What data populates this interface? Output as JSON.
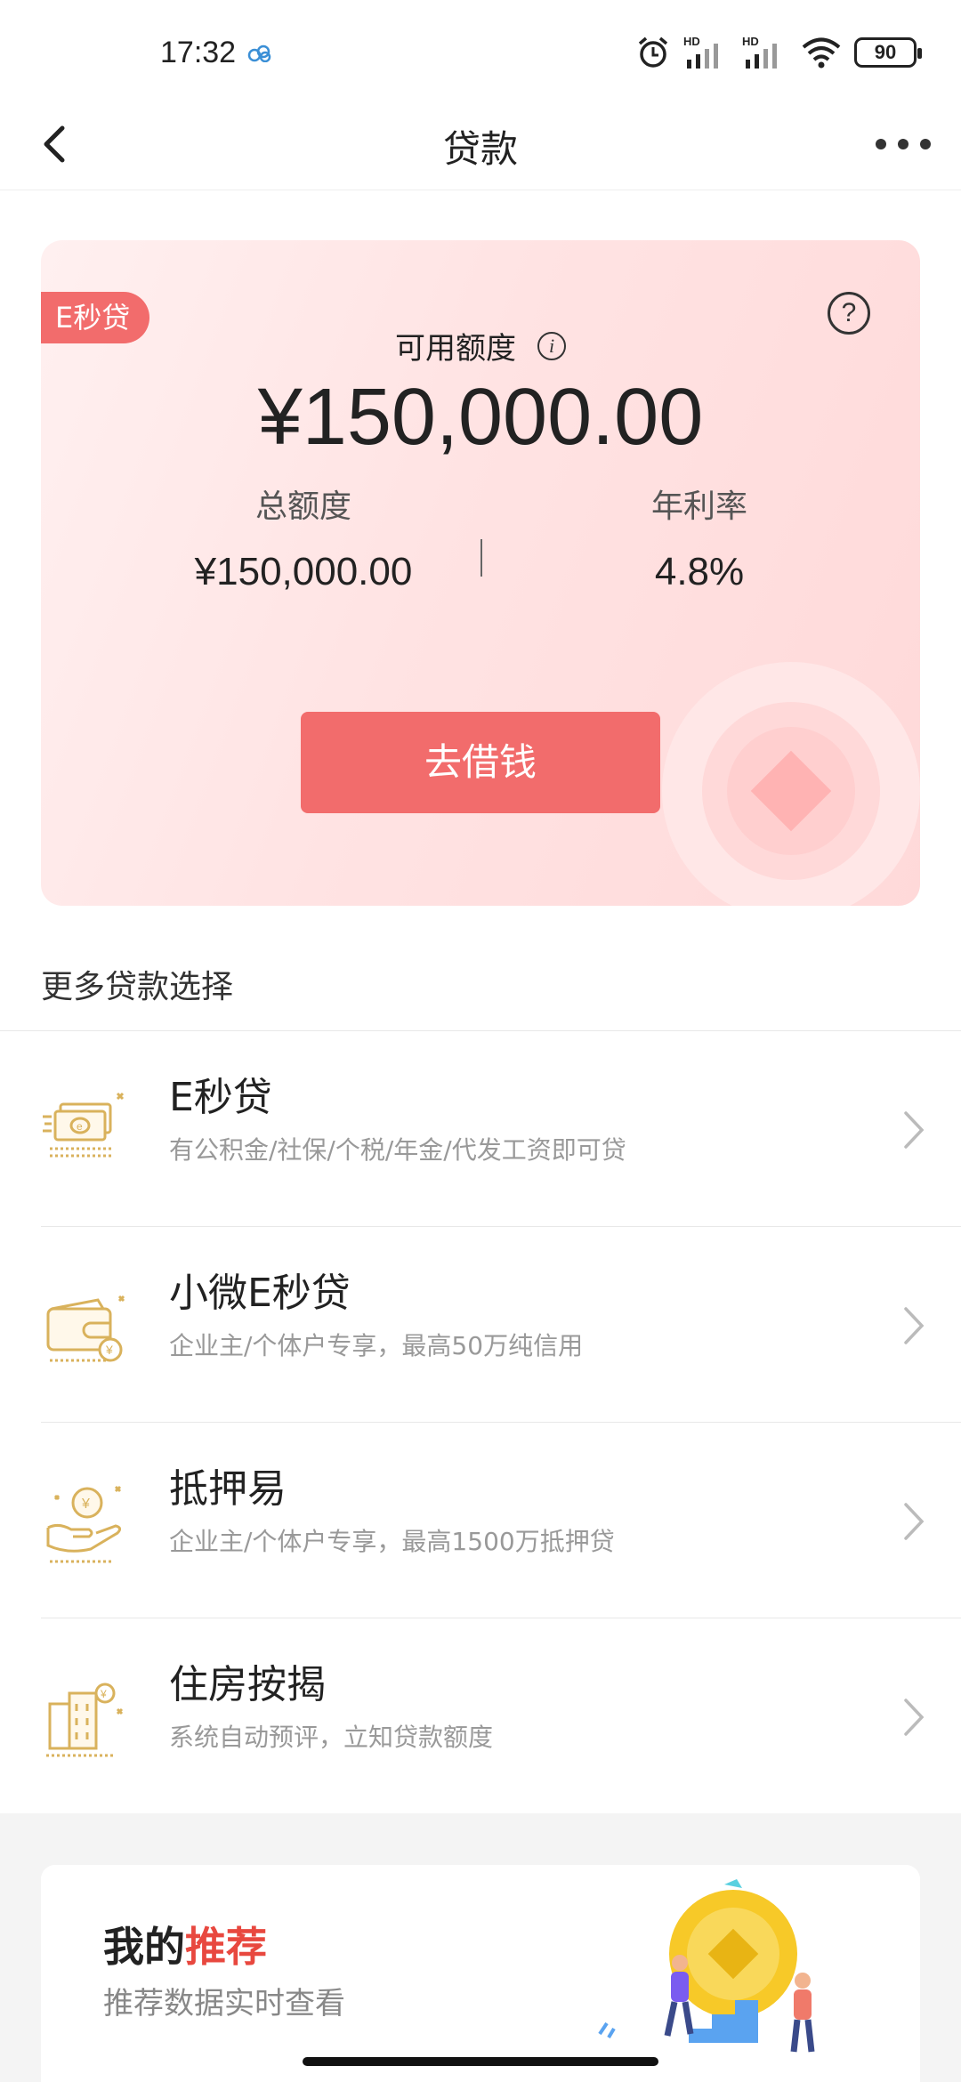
{
  "status_bar": {
    "time": "17:32",
    "battery": "90",
    "icons": [
      "cloud-icon",
      "alarm-icon",
      "signal-hd-icon",
      "signal-hd-icon",
      "wifi-icon",
      "battery-icon"
    ]
  },
  "nav": {
    "title": "贷款",
    "back_icon": "chevron-left-icon",
    "more_icon": "more-icon"
  },
  "loan_card": {
    "tag": "E秒贷",
    "available_label": "可用额度",
    "available_amount": "¥150,000.00",
    "total_label": "总额度",
    "total_value": "¥150,000.00",
    "rate_label": "年利率",
    "rate_value": "4.8%",
    "borrow_button": "去借钱",
    "help_icon": "help-icon",
    "info_icon": "info-icon"
  },
  "more_loans": {
    "title": "更多贷款选择",
    "items": [
      {
        "name": "E秒贷",
        "desc": "有公积金/社保/个税/年金/代发工资即可贷",
        "icon": "cash-stack-icon"
      },
      {
        "name": "小微E秒贷",
        "desc": "企业主/个体户专享，最高50万纯信用",
        "icon": "wallet-icon"
      },
      {
        "name": "抵押易",
        "desc": "企业主/个体户专享，最高1500万抵押贷",
        "icon": "hand-coin-icon"
      },
      {
        "name": "住房按揭",
        "desc": "系统自动预评，立知贷款额度",
        "icon": "building-icon"
      }
    ]
  },
  "recommend": {
    "title_prefix": "我的",
    "title_accent": "推荐",
    "subtitle": "推荐数据实时查看"
  },
  "colors": {
    "accent": "#f26c6c",
    "icon_gold": "#d9b25c",
    "card_bg": "#ffe3e3"
  }
}
